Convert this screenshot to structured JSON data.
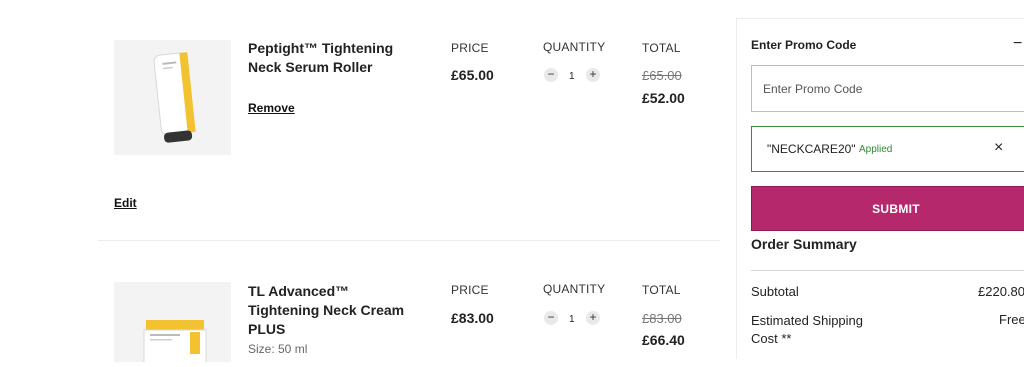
{
  "cart": {
    "items": [
      {
        "name": "Peptight™ Tightening Neck Serum Roller",
        "price_header": "PRICE",
        "price": "£65.00",
        "quantity_header": "QUANTITY",
        "quantity": "1",
        "total_header": "TOTAL",
        "original_total": "£65.00",
        "discounted_total": "£52.00",
        "remove_label": "Remove",
        "edit_label": "Edit"
      },
      {
        "name": "TL Advanced™ Tightening Neck Cream PLUS",
        "size": "Size: 50 ml",
        "price_header": "PRICE",
        "price": "£83.00",
        "quantity_header": "QUANTITY",
        "quantity": "1",
        "total_header": "TOTAL",
        "original_total": "£83.00",
        "discounted_total": "£66.40"
      }
    ]
  },
  "sidebar": {
    "promo_heading": "Enter Promo Code",
    "collapse_symbol": "−",
    "promo_placeholder": "Enter Promo Code",
    "applied_code": "\"NECKCARE20\"",
    "applied_label": "Applied",
    "remove_code_symbol": "×",
    "submit_label": "SUBMIT",
    "summary_heading": "Order Summary",
    "subtotal_label": "Subtotal",
    "subtotal_value": "£220.80",
    "shipping_label_line1": "Estimated Shipping",
    "shipping_label_line2": "Cost **",
    "shipping_value": "Free"
  },
  "colors": {
    "submit_bg": "#b5286b",
    "applied_border": "#3a8a3a",
    "applied_text": "#2e8b2e",
    "product_accent": "#f2c230"
  },
  "icons": {
    "collapse": "minus-icon",
    "qty_decrease": "minus-icon",
    "qty_increase": "plus-icon",
    "remove_code": "close-icon"
  }
}
